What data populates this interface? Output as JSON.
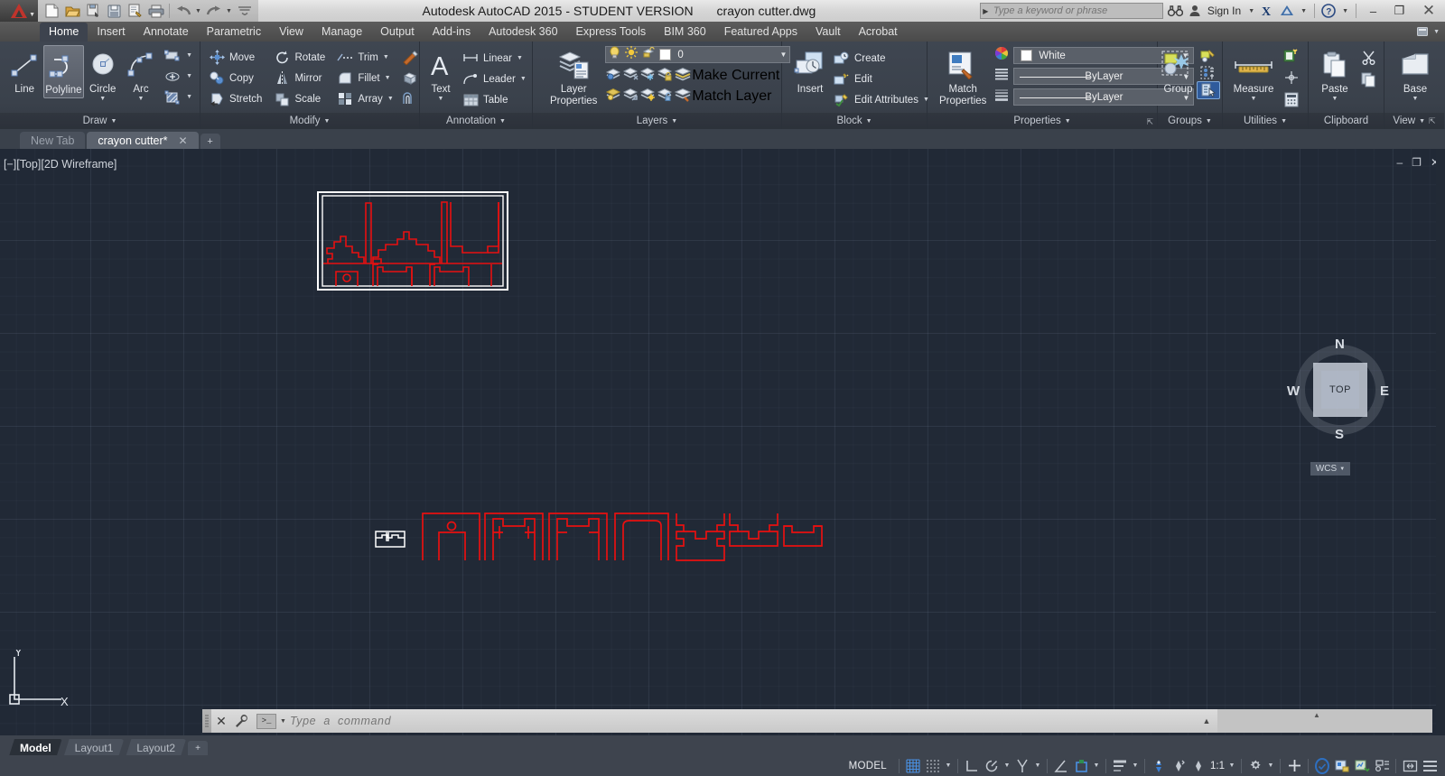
{
  "titlebar": {
    "app_title": "Autodesk AutoCAD 2015 - STUDENT VERSION",
    "file_name": "crayon cutter.dwg",
    "search_placeholder": "Type a keyword or phrase",
    "sign_in": "Sign In",
    "quick_access": [
      {
        "name": "new-icon",
        "label": "New"
      },
      {
        "name": "open-icon",
        "label": "Open"
      },
      {
        "name": "save-icon",
        "label": "Save"
      },
      {
        "name": "saveas-icon",
        "label": "Save As"
      },
      {
        "name": "plot-icon",
        "label": "Plot"
      },
      {
        "name": "print-icon",
        "label": "Print"
      },
      {
        "name": "undo-icon",
        "label": "Undo"
      },
      {
        "name": "redo-icon",
        "label": "Redo"
      },
      {
        "name": "qat-more-icon",
        "label": "Customize Quick Access Toolbar"
      }
    ],
    "window_controls": {
      "minimize": "–",
      "maximize": "❐",
      "close": "✕"
    }
  },
  "ribbon_tabs": [
    {
      "label": "Home",
      "active": true
    },
    {
      "label": "Insert",
      "active": false
    },
    {
      "label": "Annotate",
      "active": false
    },
    {
      "label": "Parametric",
      "active": false
    },
    {
      "label": "View",
      "active": false
    },
    {
      "label": "Manage",
      "active": false
    },
    {
      "label": "Output",
      "active": false
    },
    {
      "label": "Add-ins",
      "active": false
    },
    {
      "label": "Autodesk 360",
      "active": false
    },
    {
      "label": "Express Tools",
      "active": false
    },
    {
      "label": "BIM 360",
      "active": false
    },
    {
      "label": "Featured Apps",
      "active": false
    },
    {
      "label": "Vault",
      "active": false
    },
    {
      "label": "Acrobat",
      "active": false
    }
  ],
  "panels": {
    "draw": {
      "title": "Draw",
      "buttons": [
        {
          "label": "Line",
          "icon": "line-icon",
          "selected": false,
          "dropdown": false
        },
        {
          "label": "Polyline",
          "icon": "polyline-icon",
          "selected": true,
          "dropdown": false
        },
        {
          "label": "Circle",
          "icon": "circle-icon",
          "selected": false,
          "dropdown": true
        },
        {
          "label": "Arc",
          "icon": "arc-icon",
          "selected": false,
          "dropdown": true
        }
      ],
      "small": [
        {
          "label": "",
          "icon": "rectangle-icon"
        },
        {
          "label": "",
          "icon": "ellipse-icon"
        },
        {
          "label": "",
          "icon": "hatch-icon"
        }
      ]
    },
    "modify": {
      "title": "Modify",
      "items": [
        {
          "label": "Move",
          "icon": "move-icon",
          "dropdown": false
        },
        {
          "label": "Rotate",
          "icon": "rotate-icon",
          "dropdown": false
        },
        {
          "label": "Trim",
          "icon": "trim-icon",
          "dropdown": true
        },
        {
          "label": "Copy",
          "icon": "copy-icon",
          "dropdown": false
        },
        {
          "label": "Mirror",
          "icon": "mirror-icon",
          "dropdown": false
        },
        {
          "label": "Fillet",
          "icon": "fillet-icon",
          "dropdown": true
        },
        {
          "label": "Stretch",
          "icon": "stretch-icon",
          "dropdown": false
        },
        {
          "label": "Scale",
          "icon": "scale-icon",
          "dropdown": false
        },
        {
          "label": "Array",
          "icon": "array-icon",
          "dropdown": true
        }
      ],
      "extras": [
        {
          "icon": "explode-icon"
        },
        {
          "icon": "3d-extrude-icon"
        },
        {
          "icon": "offset-icon"
        }
      ]
    },
    "annotation": {
      "title": "Annotation",
      "big": {
        "label": "Text",
        "icon": "text-icon",
        "dropdown": true
      },
      "items": [
        {
          "label": "Linear",
          "icon": "linear-dimension-icon",
          "dropdown": true
        },
        {
          "label": "Leader",
          "icon": "leader-icon",
          "dropdown": true
        },
        {
          "label": "Table",
          "icon": "table-icon",
          "dropdown": false
        }
      ]
    },
    "layers": {
      "title": "Layers",
      "big": {
        "label_line1": "Layer",
        "label_line2": "Properties",
        "icon": "layer-properties-icon"
      },
      "current_layer": "0",
      "layer_state_icons": [
        "lightbulb-icon",
        "sun-icon",
        "unlock-icon",
        "layer-color-swatch"
      ],
      "items": [
        {
          "label": "Make Current",
          "icon": "make-current-icon"
        },
        {
          "label": "Match Layer",
          "icon": "match-layer-icon"
        }
      ],
      "tool_icons": [
        "layer-isolate-icon",
        "layer-off-icon",
        "layer-freeze-icon",
        "layer-lock-icon",
        "layer-unisolate-icon",
        "layer-on-icon",
        "layer-thaw-icon",
        "layer-unlock-icon"
      ]
    },
    "block": {
      "title": "Block",
      "big": {
        "label": "Insert",
        "icon": "insert-block-icon"
      },
      "items": [
        {
          "label": "Create",
          "icon": "create-block-icon",
          "dropdown": false
        },
        {
          "label": "Edit",
          "icon": "edit-block-icon",
          "dropdown": false
        },
        {
          "label": "Edit Attributes",
          "icon": "edit-attributes-icon",
          "dropdown": true
        }
      ]
    },
    "properties": {
      "title": "Properties",
      "big": {
        "label_line1": "Match",
        "label_line2": "Properties",
        "icon": "match-properties-icon"
      },
      "color": "White",
      "linetype": "ByLayer",
      "lineweight": "ByLayer",
      "color_hex": "#ffffff"
    },
    "groups": {
      "title": "Groups",
      "big": {
        "label": "Group",
        "icon": "group-icon"
      },
      "tools": [
        {
          "icon": "ungroup-icon",
          "selected": false
        },
        {
          "icon": "group-edit-icon",
          "selected": false
        },
        {
          "icon": "group-selection-on-off-icon",
          "selected": true
        }
      ]
    },
    "utilities": {
      "title": "Utilities",
      "big": {
        "label": "Measure",
        "icon": "measure-icon",
        "dropdown": true
      },
      "tools": [
        {
          "icon": "quick-select-icon"
        },
        {
          "icon": "point-id-icon"
        },
        {
          "icon": "calculator-icon"
        }
      ]
    },
    "clipboard": {
      "title": "Clipboard",
      "big": {
        "label": "Paste",
        "icon": "paste-icon",
        "dropdown": true
      },
      "tools": [
        {
          "icon": "cut-icon"
        },
        {
          "icon": "copy-clip-icon"
        }
      ]
    },
    "view": {
      "title": "View",
      "big": {
        "label": "Base",
        "icon": "base-view-icon",
        "dropdown": true
      }
    }
  },
  "doc_tabs": [
    {
      "label": "New Tab",
      "active": false,
      "closable": false
    },
    {
      "label": "crayon cutter*",
      "active": true,
      "closable": true
    }
  ],
  "doc_tab_add": "+",
  "canvas": {
    "viewport_label": "[−][Top][2D Wireframe]",
    "viewport_controls": [
      "minimize-viewport-icon",
      "maximize-viewport-icon",
      "close-viewport-icon"
    ],
    "viewcube": {
      "top": "TOP",
      "north": "N",
      "south": "S",
      "east": "E",
      "west": "W"
    },
    "wcs": "WCS",
    "ucs_axes": {
      "x": "X",
      "y": "Y"
    },
    "geometry_color": "#e81010",
    "selected_color": "#ffffff",
    "background": "#212936"
  },
  "command_line": {
    "placeholder": "Type  a  command",
    "prompt_glyph": ">_",
    "close_label": "✕"
  },
  "layout_tabs": [
    {
      "label": "Model",
      "active": true
    },
    {
      "label": "Layout1",
      "active": false
    },
    {
      "label": "Layout2",
      "active": false
    }
  ],
  "layout_tab_add": "+",
  "status_bar": {
    "space_label": "MODEL",
    "scale": "1:1",
    "toggles": [
      {
        "name": "grid-display-toggle",
        "on": true
      },
      {
        "name": "snap-mode-toggle",
        "on": false
      },
      {
        "name": "ortho-mode-toggle",
        "on": false
      },
      {
        "name": "polar-tracking-toggle",
        "on": false
      },
      {
        "name": "object-snap-tracking-toggle",
        "on": false
      },
      {
        "name": "object-snap-toggle",
        "on": true
      },
      {
        "name": "lineweight-toggle",
        "on": false
      },
      {
        "name": "annotation-visibility-toggle",
        "on": true
      },
      {
        "name": "annotation-autoscale-toggle",
        "on": false
      },
      {
        "name": "annotation-scale-toggle",
        "on": false
      },
      {
        "name": "workspace-switching-icon",
        "on": false
      },
      {
        "name": "hardware-acceleration-icon",
        "on": true
      },
      {
        "name": "isolate-objects-icon",
        "on": false
      },
      {
        "name": "fullscreen-icon",
        "on": false
      },
      {
        "name": "customization-icon",
        "on": false
      }
    ]
  }
}
